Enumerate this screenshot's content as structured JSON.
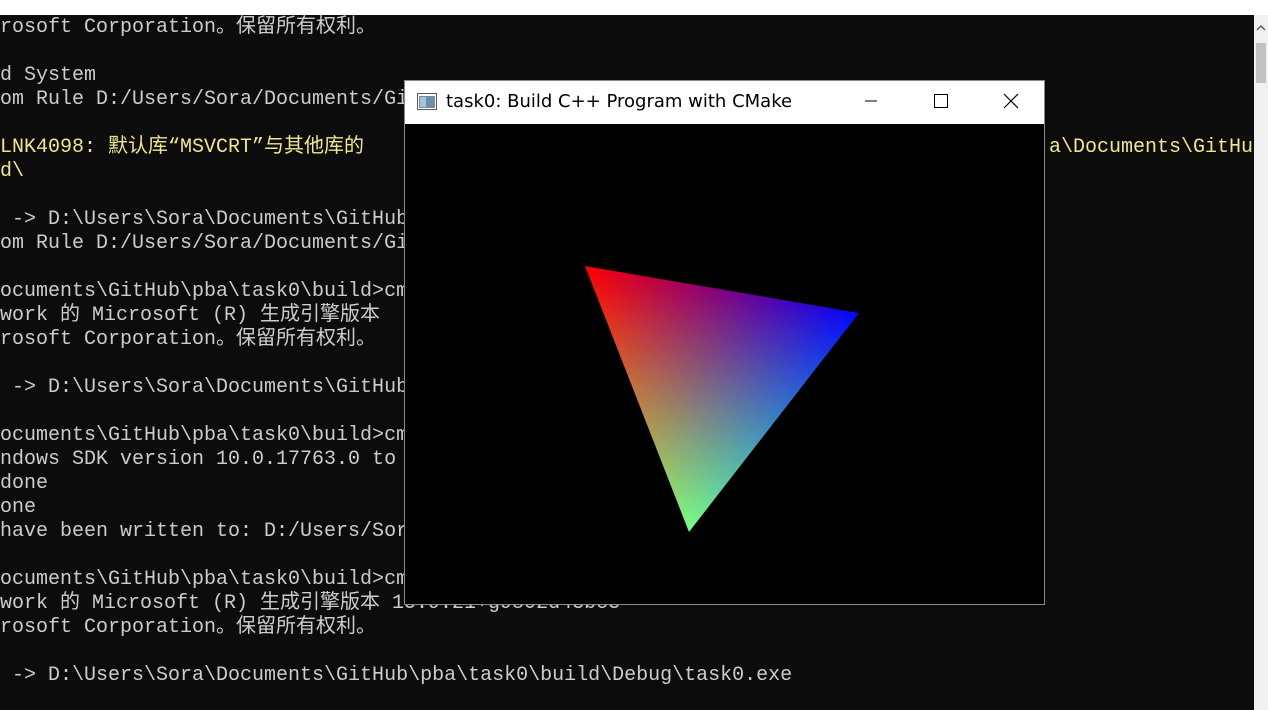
{
  "console": {
    "lines": [
      {
        "text": "rosoft Corporation。保留所有权利。",
        "style": "normal"
      },
      {
        "text": "d System",
        "style": "normal"
      },
      {
        "text": "om Rule D:/Users/Sora/Documents/Gi",
        "style": "normal"
      },
      {
        "text": "LNK4098: 默认库“MSVCRT”与其他库的",
        "style": "warn"
      },
      {
        "text": "a\\Documents\\GitHub",
        "style": "warn"
      },
      {
        "text": "d\\",
        "style": "warn"
      },
      {
        "text": " -> D:\\Users\\Sora\\Documents\\GitHub",
        "style": "normal"
      },
      {
        "text": "om Rule D:/Users/Sora/Documents/Gi",
        "style": "normal"
      },
      {
        "text": "ocuments\\GitHub\\pba\\task0\\build>cm",
        "style": "normal"
      },
      {
        "text": "work 的 Microsoft (R) 生成引擎版本",
        "style": "normal"
      },
      {
        "text": "rosoft Corporation。保留所有权利。",
        "style": "normal"
      },
      {
        "text": " -> D:\\Users\\Sora\\Documents\\GitHub",
        "style": "normal"
      },
      {
        "text": "ocuments\\GitHub\\pba\\task0\\build>cm",
        "style": "normal"
      },
      {
        "text": "ndows SDK version 10.0.17763.0 to",
        "style": "normal"
      },
      {
        "text": "done",
        "style": "normal"
      },
      {
        "text": "one",
        "style": "normal"
      },
      {
        "text": "have been written to: D:/Users/Sora",
        "style": "normal"
      },
      {
        "text": "ocuments\\GitHub\\pba\\task0\\build>cm",
        "style": "normal"
      },
      {
        "text": "work 的 Microsoft (R) 生成引擎版本 15.9.21+g9802d43bc3",
        "style": "normal"
      },
      {
        "text": "rosoft Corporation。保留所有权利。",
        "style": "normal"
      },
      {
        "text": " -> D:\\Users\\Sora\\Documents\\GitHub\\pba\\task0\\build\\Debug\\task0.exe",
        "style": "normal"
      }
    ]
  },
  "gl_window": {
    "title": "task0: Build C++ Program with CMake",
    "icon": "app-window-icon",
    "buttons": {
      "minimize": "minimize-icon",
      "maximize": "maximize-icon",
      "close": "close-icon"
    },
    "triangle_colors": {
      "top_left": "#ff0000",
      "right": "#0000ff",
      "bottom": "#00ff00"
    }
  },
  "colors": {
    "console_bg": "#0c0c0c",
    "console_text": "#cccccc",
    "warning_text": "#f0e68c",
    "viewport_bg": "#000000"
  }
}
